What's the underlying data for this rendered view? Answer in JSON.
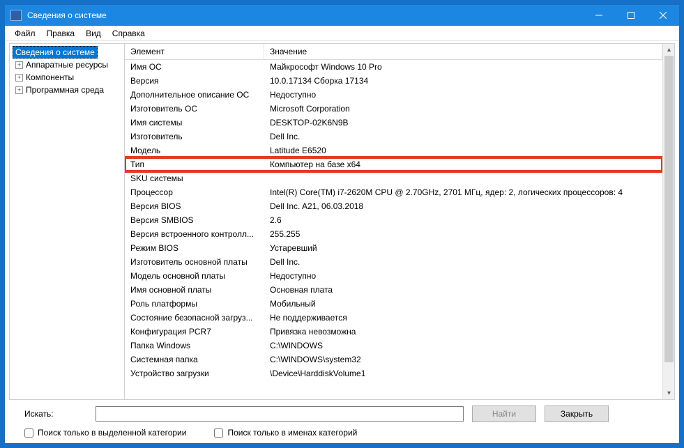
{
  "title": "Сведения о системе",
  "menu": {
    "file": "Файл",
    "edit": "Правка",
    "view": "Вид",
    "help": "Справка"
  },
  "tree": {
    "root": "Сведения о системе",
    "nodes": [
      {
        "label": "Аппаратные ресурсы"
      },
      {
        "label": "Компоненты"
      },
      {
        "label": "Программная среда"
      }
    ]
  },
  "table": {
    "headers": {
      "col1": "Элемент",
      "col2": "Значение"
    },
    "rows": [
      {
        "k": "Имя ОС",
        "v": "Майкрософт Windows 10 Pro"
      },
      {
        "k": "Версия",
        "v": "10.0.17134 Сборка 17134"
      },
      {
        "k": "Дополнительное описание ОС",
        "v": "Недоступно"
      },
      {
        "k": "Изготовитель ОС",
        "v": "Microsoft Corporation"
      },
      {
        "k": "Имя системы",
        "v": "DESKTOP-02K6N9B"
      },
      {
        "k": "Изготовитель",
        "v": "Dell Inc."
      },
      {
        "k": "Модель",
        "v": "Latitude E6520"
      },
      {
        "k": "Тип",
        "v": "Компьютер на базе x64",
        "hl": true
      },
      {
        "k": "SKU системы",
        "v": ""
      },
      {
        "k": "Процессор",
        "v": "Intel(R) Core(TM) i7-2620M CPU @ 2.70GHz, 2701 МГц, ядер: 2, логических процессоров: 4"
      },
      {
        "k": "Версия BIOS",
        "v": "Dell Inc. A21, 06.03.2018"
      },
      {
        "k": "Версия SMBIOS",
        "v": "2.6"
      },
      {
        "k": "Версия встроенного контролл...",
        "v": "255.255"
      },
      {
        "k": "Режим BIOS",
        "v": "Устаревший"
      },
      {
        "k": "Изготовитель основной платы",
        "v": "Dell Inc."
      },
      {
        "k": "Модель основной платы",
        "v": "Недоступно"
      },
      {
        "k": "Имя основной платы",
        "v": "Основная плата"
      },
      {
        "k": "Роль платформы",
        "v": "Мобильный"
      },
      {
        "k": "Состояние безопасной загруз...",
        "v": "Не поддерживается"
      },
      {
        "k": "Конфигурация PCR7",
        "v": "Привязка невозможна"
      },
      {
        "k": "Папка Windows",
        "v": "C:\\WINDOWS"
      },
      {
        "k": "Системная папка",
        "v": "C:\\WINDOWS\\system32"
      },
      {
        "k": "Устройство загрузки",
        "v": "\\Device\\HarddiskVolume1"
      }
    ]
  },
  "bottom": {
    "search_label": "Искать:",
    "find_btn": "Найти",
    "close_btn": "Закрыть",
    "cb1": "Поиск только в выделенной категории",
    "cb2": "Поиск только в именах категорий"
  }
}
